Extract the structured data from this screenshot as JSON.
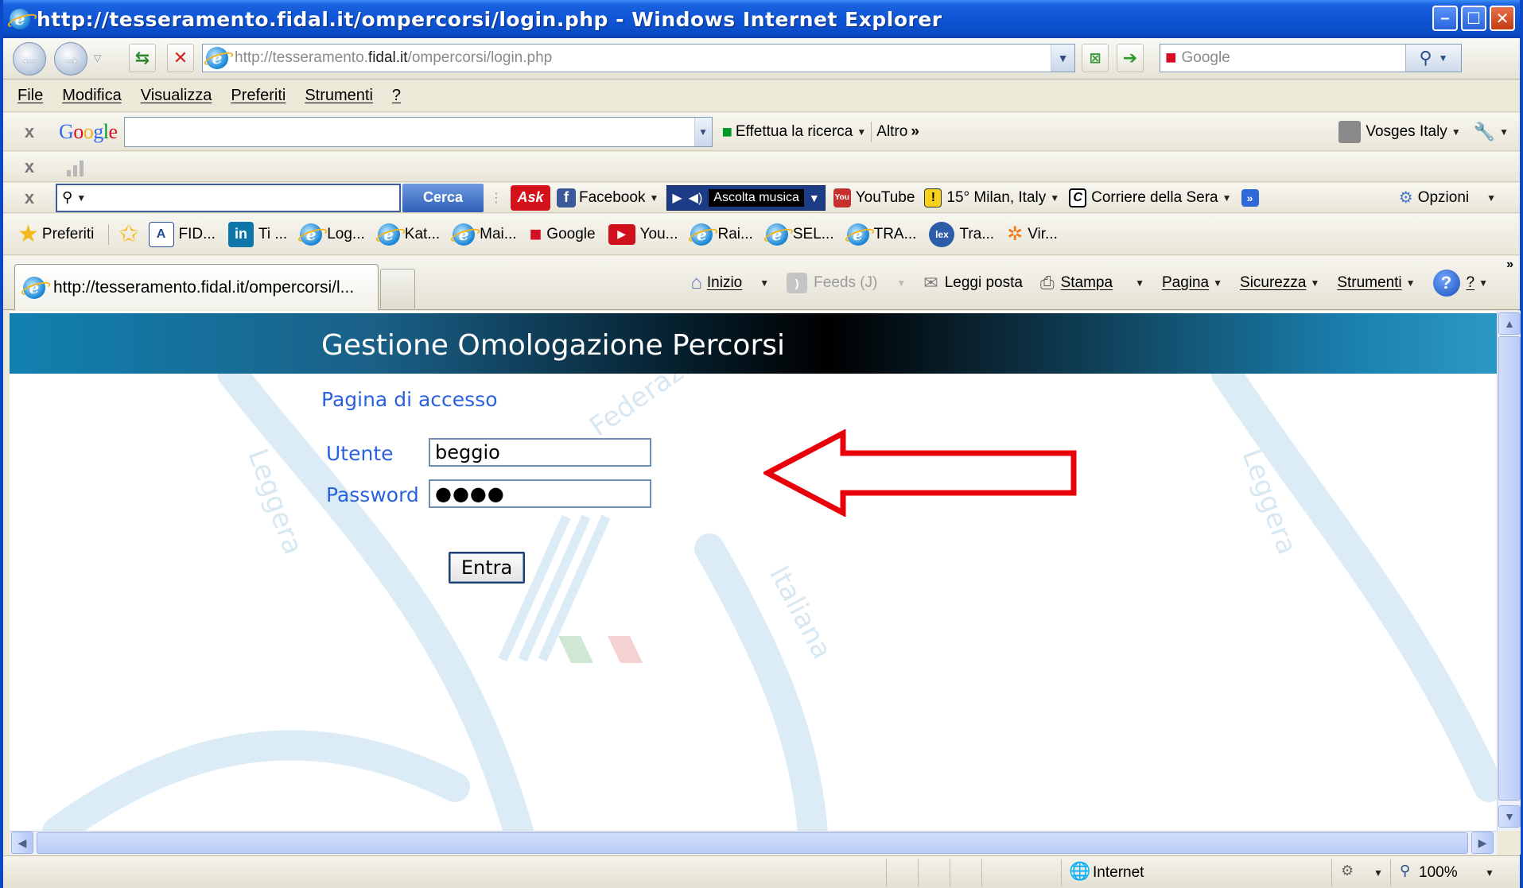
{
  "window": {
    "title": "http://tesseramento.fidal.it/ompercorsi/login.php - Windows Internet Explorer",
    "controls": [
      "minimize",
      "maximize",
      "close"
    ]
  },
  "address_bar": {
    "url_prefix": "http://tesseramento.",
    "url_domain": "fidal.it",
    "url_suffix": "/ompercorsi/login.php",
    "search_placeholder": "Google"
  },
  "menu": [
    "File",
    "Modifica",
    "Visualizza",
    "Preferiti",
    "Strumenti",
    "?"
  ],
  "google_toolbar": {
    "logo": "Google",
    "search_button": "Effettua la ricerca",
    "more": "Altro",
    "account": "Vosges Italy"
  },
  "ask_toolbar": {
    "search_button": "Cerca",
    "items": [
      "Facebook",
      "Ascolta musica",
      "YouTube",
      "15° Milan, Italy",
      "Corriere della Sera"
    ],
    "options": "Opzioni"
  },
  "favorites_bar": {
    "label": "Preferiti",
    "items": [
      "FID...",
      "Ti ...",
      "Log...",
      "Kat...",
      "Mai...",
      "Google",
      "You...",
      "Rai...",
      "SEL...",
      "TRA...",
      "Tra...",
      "Vir..."
    ]
  },
  "tab": {
    "title": "http://tesseramento.fidal.it/ompercorsi/l..."
  },
  "command_bar": {
    "home": "Inizio",
    "feeds": "Feeds (J)",
    "mail": "Leggi posta",
    "print": "Stampa",
    "page": "Pagina",
    "safety": "Sicurezza",
    "tools": "Strumenti",
    "help": "?"
  },
  "page": {
    "banner_title": "Gestione Omologazione Percorsi",
    "subtitle": "Pagina di accesso",
    "user_label": "Utente",
    "user_value": "beggio",
    "password_label": "Password",
    "password_value": "●●●●",
    "submit_label": "Entra",
    "watermark_texts": [
      "Leggera",
      "Federazione",
      "Italiana",
      "Leggera"
    ]
  },
  "status_bar": {
    "zone": "Internet",
    "zoom": "100%"
  },
  "colors": {
    "titlebar": "#0a4cc6",
    "link_blue": "#2a62e0",
    "arrow_red": "#e8000a"
  }
}
